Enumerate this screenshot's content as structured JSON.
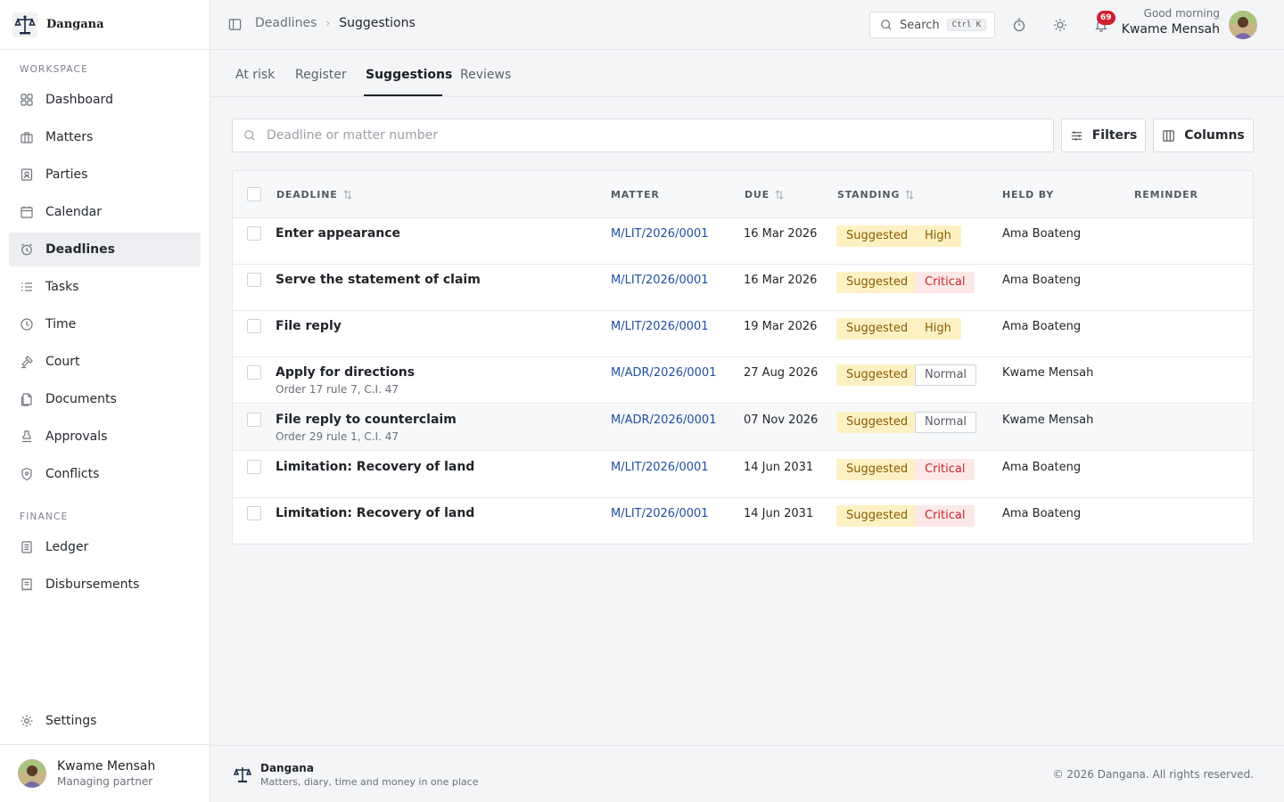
{
  "app": {
    "name": "Dangana",
    "tagline": "Matters, diary, time and money in one place",
    "copyright": "© 2026 Dangana. All rights reserved."
  },
  "sidebar": {
    "workspace_label": "WORKSPACE",
    "finance_label": "FINANCE",
    "items": [
      {
        "label": "Dashboard",
        "icon": "dashboard-icon"
      },
      {
        "label": "Matters",
        "icon": "briefcase-icon"
      },
      {
        "label": "Parties",
        "icon": "contact-card-icon"
      },
      {
        "label": "Calendar",
        "icon": "calendar-icon"
      },
      {
        "label": "Deadlines",
        "icon": "alarm-clock-icon",
        "active": true
      },
      {
        "label": "Tasks",
        "icon": "task-list-icon"
      },
      {
        "label": "Time",
        "icon": "clock-icon"
      },
      {
        "label": "Court",
        "icon": "gavel-icon"
      },
      {
        "label": "Documents",
        "icon": "documents-icon"
      }
    ],
    "items2": [
      {
        "label": "Approvals",
        "icon": "stamp-icon"
      },
      {
        "label": "Conflicts",
        "icon": "shield-icon"
      }
    ],
    "finance_items": [
      {
        "label": "Ledger",
        "icon": "ledger-icon"
      },
      {
        "label": "Disbursements",
        "icon": "receipt-icon"
      }
    ],
    "settings_label": "Settings",
    "user": {
      "name": "Kwame Mensah",
      "role": "Managing partner"
    }
  },
  "topbar": {
    "breadcrumb": [
      "Deadlines",
      "Suggestions"
    ],
    "search_label": "Search",
    "search_shortcut": "Ctrl K",
    "notifications_count": "69",
    "greeting": "Good morning",
    "user_name": "Kwame Mensah"
  },
  "tabs": [
    "At risk",
    "Register",
    "Suggestions",
    "Reviews"
  ],
  "active_tab": "Suggestions",
  "filter": {
    "placeholder": "Deadline or matter number",
    "filters_label": "Filters",
    "columns_label": "Columns"
  },
  "table": {
    "headers": {
      "deadline": "DEADLINE",
      "matter": "MATTER",
      "due": "DUE",
      "standing": "STANDING",
      "held_by": "HELD BY",
      "reminder": "REMINDER"
    },
    "rows": [
      {
        "deadline": "Enter appearance",
        "sub": "",
        "matter": "M/LIT/2026/0001",
        "due": "16 Mar 2026",
        "status": "Suggested",
        "priority": "High",
        "held_by": "Ama Boateng",
        "reminder": ""
      },
      {
        "deadline": "Serve the statement of claim",
        "sub": "",
        "matter": "M/LIT/2026/0001",
        "due": "16 Mar 2026",
        "status": "Suggested",
        "priority": "Critical",
        "held_by": "Ama Boateng",
        "reminder": ""
      },
      {
        "deadline": "File reply",
        "sub": "",
        "matter": "M/LIT/2026/0001",
        "due": "19 Mar 2026",
        "status": "Suggested",
        "priority": "High",
        "held_by": "Ama Boateng",
        "reminder": ""
      },
      {
        "deadline": "Apply for directions",
        "sub": "Order 17 rule 7, C.I. 47",
        "matter": "M/ADR/2026/0001",
        "due": "27 Aug 2026",
        "status": "Suggested",
        "priority": "Normal",
        "held_by": "Kwame Mensah",
        "reminder": ""
      },
      {
        "deadline": "File reply to counterclaim",
        "sub": "Order 29 rule 1, C.I. 47",
        "matter": "M/ADR/2026/0001",
        "due": "07 Nov 2026",
        "status": "Suggested",
        "priority": "Normal",
        "held_by": "Kwame Mensah",
        "reminder": "",
        "highlighted": true
      },
      {
        "deadline": "Limitation: Recovery of land",
        "sub": "",
        "matter": "M/LIT/2026/0001",
        "due": "14 Jun 2031",
        "status": "Suggested",
        "priority": "Critical",
        "held_by": "Ama Boateng",
        "reminder": ""
      },
      {
        "deadline": "Limitation: Recovery of land",
        "sub": "",
        "matter": "M/LIT/2026/0001",
        "due": "14 Jun 2031",
        "status": "Suggested",
        "priority": "Critical",
        "held_by": "Ama Boateng",
        "reminder": ""
      }
    ]
  },
  "colors": {
    "link": "#1f4fa0",
    "suggested_bg": "#fdf1c4",
    "critical": "#c62828",
    "badge": "#d0202e"
  }
}
